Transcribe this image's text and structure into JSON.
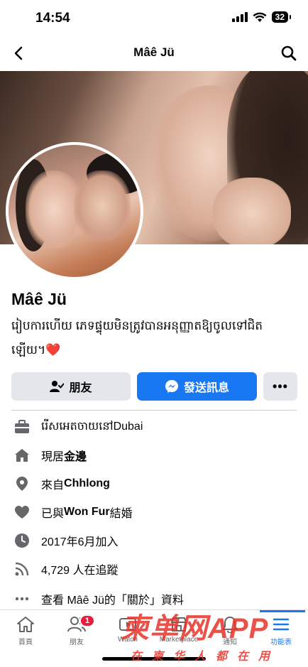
{
  "status_bar": {
    "time": "14:54",
    "battery": "32"
  },
  "header": {
    "title": "Mâê Jü"
  },
  "profile": {
    "name": "Mâê Jü",
    "bio": "រៀបការហើយ ភេទផ្ទុយមិនត្រូវបានអនុញ្ញាតឱ្យចូលទៅជិតឡើយ។",
    "bio_emoji": "❤️"
  },
  "actions": {
    "friend_label": "朋友",
    "message_label": "發送訊息",
    "more_label": "•••"
  },
  "details": [
    {
      "icon": "briefcase-icon",
      "text": "រើសអេតចាយនៅDubai"
    },
    {
      "icon": "home-icon",
      "prefix": "現居",
      "bold": "金邊"
    },
    {
      "icon": "location-pin-icon",
      "prefix": "來自 ",
      "bold": "Chhlong"
    },
    {
      "icon": "heart-icon",
      "prefix": "已與 ",
      "bold": "Won Fur",
      "suffix": " 結婚"
    },
    {
      "icon": "clock-icon",
      "text": "2017年6月加入"
    },
    {
      "icon": "rss-icon",
      "text": "4,729 人在追蹤"
    },
    {
      "icon": "more-dots-icon",
      "text": "查看 Mâê Jü的「關於」資料"
    }
  ],
  "tabbar": {
    "items": [
      {
        "label": "首頁",
        "icon": "home-icon"
      },
      {
        "label": "朋友",
        "icon": "friends-icon",
        "badge": "1"
      },
      {
        "label": "Watch",
        "icon": "video-icon"
      },
      {
        "label": "Marketplace",
        "icon": "shop-icon"
      },
      {
        "label": "通知",
        "icon": "bell-icon"
      },
      {
        "label": "功能表",
        "icon": "menu-icon"
      }
    ]
  },
  "watermark": {
    "main": "柬单网APP",
    "sub": "在柬华人都在用"
  },
  "colors": {
    "accent": "#1877f2",
    "button_gray": "#e4e6eb",
    "badge": "#e41e3f"
  }
}
